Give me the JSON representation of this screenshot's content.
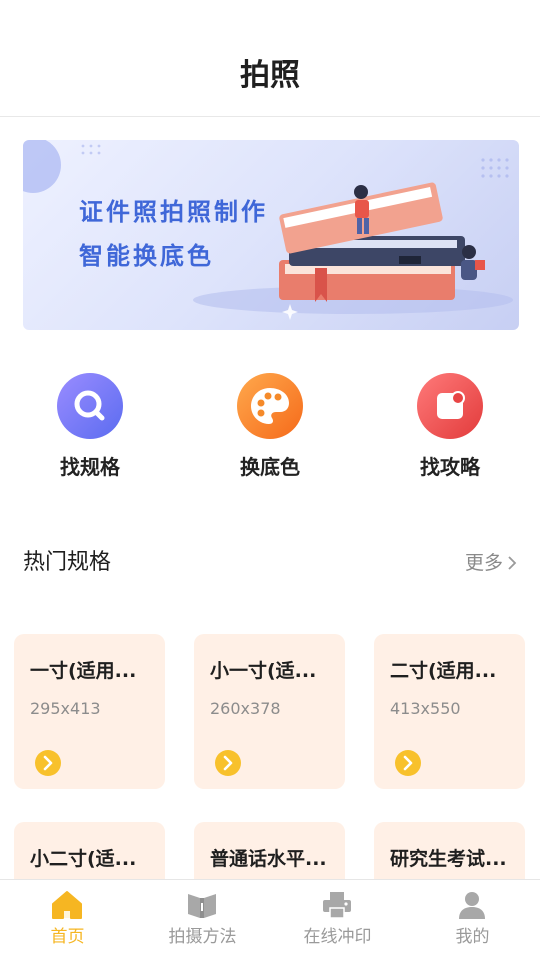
{
  "header": {
    "title": "拍照"
  },
  "banner": {
    "line1": "证件照拍照制作",
    "line2": "智能换底色"
  },
  "features": [
    {
      "label": "找规格",
      "icon": "search-icon"
    },
    {
      "label": "换底色",
      "icon": "palette-icon"
    },
    {
      "label": "找攻略",
      "icon": "guide-icon"
    }
  ],
  "section": {
    "title": "热门规格",
    "more": "更多"
  },
  "cards": [
    {
      "name": "一寸(适用...",
      "size": "295x413"
    },
    {
      "name": "小一寸(适...",
      "size": "260x378"
    },
    {
      "name": "二寸(适用...",
      "size": "413x550"
    },
    {
      "name": "小二寸(适...",
      "size": ""
    },
    {
      "name": "普通话水平...",
      "size": ""
    },
    {
      "name": "研究生考试...",
      "size": ""
    }
  ],
  "tabbar": {
    "items": [
      {
        "label": "首页",
        "icon": "home-icon",
        "active": true
      },
      {
        "label": "拍摄方法",
        "icon": "book-icon",
        "active": false
      },
      {
        "label": "在线冲印",
        "icon": "printer-icon",
        "active": false
      },
      {
        "label": "我的",
        "icon": "user-icon",
        "active": false
      }
    ]
  },
  "colors": {
    "accent": "#f6b622",
    "bannerText": "#3f67d8",
    "cardBg": "#fff0e6"
  }
}
